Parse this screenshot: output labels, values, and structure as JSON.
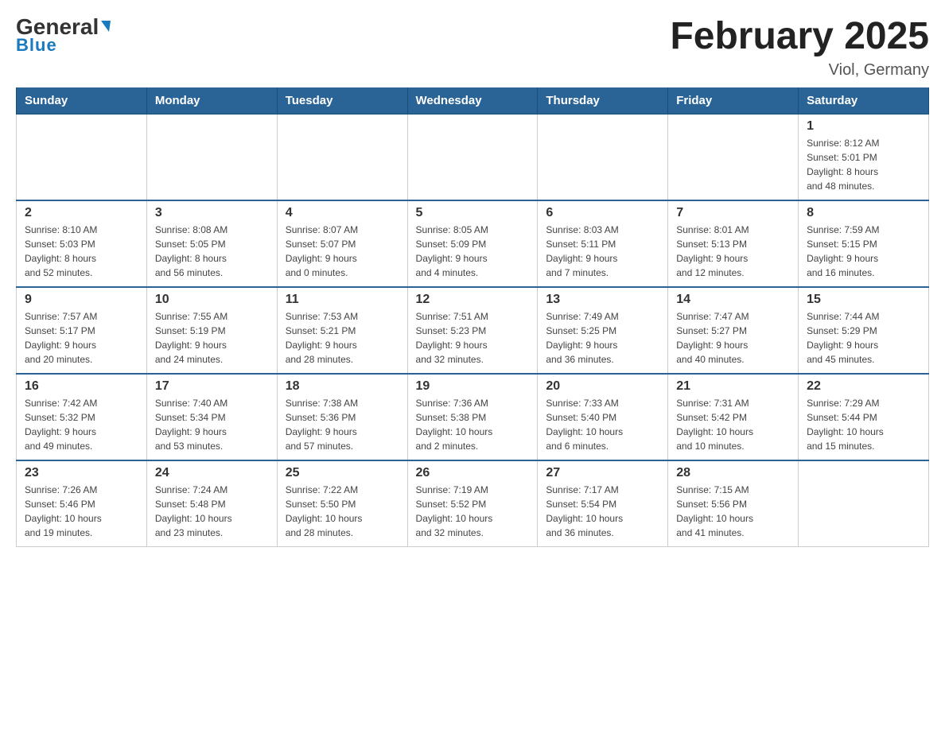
{
  "header": {
    "logo_text_black": "General",
    "logo_text_blue": "Blue",
    "month_title": "February 2025",
    "location": "Viol, Germany"
  },
  "days_of_week": [
    "Sunday",
    "Monday",
    "Tuesday",
    "Wednesday",
    "Thursday",
    "Friday",
    "Saturday"
  ],
  "weeks": [
    {
      "days": [
        {
          "number": "",
          "info": ""
        },
        {
          "number": "",
          "info": ""
        },
        {
          "number": "",
          "info": ""
        },
        {
          "number": "",
          "info": ""
        },
        {
          "number": "",
          "info": ""
        },
        {
          "number": "",
          "info": ""
        },
        {
          "number": "1",
          "info": "Sunrise: 8:12 AM\nSunset: 5:01 PM\nDaylight: 8 hours\nand 48 minutes."
        }
      ]
    },
    {
      "days": [
        {
          "number": "2",
          "info": "Sunrise: 8:10 AM\nSunset: 5:03 PM\nDaylight: 8 hours\nand 52 minutes."
        },
        {
          "number": "3",
          "info": "Sunrise: 8:08 AM\nSunset: 5:05 PM\nDaylight: 8 hours\nand 56 minutes."
        },
        {
          "number": "4",
          "info": "Sunrise: 8:07 AM\nSunset: 5:07 PM\nDaylight: 9 hours\nand 0 minutes."
        },
        {
          "number": "5",
          "info": "Sunrise: 8:05 AM\nSunset: 5:09 PM\nDaylight: 9 hours\nand 4 minutes."
        },
        {
          "number": "6",
          "info": "Sunrise: 8:03 AM\nSunset: 5:11 PM\nDaylight: 9 hours\nand 7 minutes."
        },
        {
          "number": "7",
          "info": "Sunrise: 8:01 AM\nSunset: 5:13 PM\nDaylight: 9 hours\nand 12 minutes."
        },
        {
          "number": "8",
          "info": "Sunrise: 7:59 AM\nSunset: 5:15 PM\nDaylight: 9 hours\nand 16 minutes."
        }
      ]
    },
    {
      "days": [
        {
          "number": "9",
          "info": "Sunrise: 7:57 AM\nSunset: 5:17 PM\nDaylight: 9 hours\nand 20 minutes."
        },
        {
          "number": "10",
          "info": "Sunrise: 7:55 AM\nSunset: 5:19 PM\nDaylight: 9 hours\nand 24 minutes."
        },
        {
          "number": "11",
          "info": "Sunrise: 7:53 AM\nSunset: 5:21 PM\nDaylight: 9 hours\nand 28 minutes."
        },
        {
          "number": "12",
          "info": "Sunrise: 7:51 AM\nSunset: 5:23 PM\nDaylight: 9 hours\nand 32 minutes."
        },
        {
          "number": "13",
          "info": "Sunrise: 7:49 AM\nSunset: 5:25 PM\nDaylight: 9 hours\nand 36 minutes."
        },
        {
          "number": "14",
          "info": "Sunrise: 7:47 AM\nSunset: 5:27 PM\nDaylight: 9 hours\nand 40 minutes."
        },
        {
          "number": "15",
          "info": "Sunrise: 7:44 AM\nSunset: 5:29 PM\nDaylight: 9 hours\nand 45 minutes."
        }
      ]
    },
    {
      "days": [
        {
          "number": "16",
          "info": "Sunrise: 7:42 AM\nSunset: 5:32 PM\nDaylight: 9 hours\nand 49 minutes."
        },
        {
          "number": "17",
          "info": "Sunrise: 7:40 AM\nSunset: 5:34 PM\nDaylight: 9 hours\nand 53 minutes."
        },
        {
          "number": "18",
          "info": "Sunrise: 7:38 AM\nSunset: 5:36 PM\nDaylight: 9 hours\nand 57 minutes."
        },
        {
          "number": "19",
          "info": "Sunrise: 7:36 AM\nSunset: 5:38 PM\nDaylight: 10 hours\nand 2 minutes."
        },
        {
          "number": "20",
          "info": "Sunrise: 7:33 AM\nSunset: 5:40 PM\nDaylight: 10 hours\nand 6 minutes."
        },
        {
          "number": "21",
          "info": "Sunrise: 7:31 AM\nSunset: 5:42 PM\nDaylight: 10 hours\nand 10 minutes."
        },
        {
          "number": "22",
          "info": "Sunrise: 7:29 AM\nSunset: 5:44 PM\nDaylight: 10 hours\nand 15 minutes."
        }
      ]
    },
    {
      "days": [
        {
          "number": "23",
          "info": "Sunrise: 7:26 AM\nSunset: 5:46 PM\nDaylight: 10 hours\nand 19 minutes."
        },
        {
          "number": "24",
          "info": "Sunrise: 7:24 AM\nSunset: 5:48 PM\nDaylight: 10 hours\nand 23 minutes."
        },
        {
          "number": "25",
          "info": "Sunrise: 7:22 AM\nSunset: 5:50 PM\nDaylight: 10 hours\nand 28 minutes."
        },
        {
          "number": "26",
          "info": "Sunrise: 7:19 AM\nSunset: 5:52 PM\nDaylight: 10 hours\nand 32 minutes."
        },
        {
          "number": "27",
          "info": "Sunrise: 7:17 AM\nSunset: 5:54 PM\nDaylight: 10 hours\nand 36 minutes."
        },
        {
          "number": "28",
          "info": "Sunrise: 7:15 AM\nSunset: 5:56 PM\nDaylight: 10 hours\nand 41 minutes."
        },
        {
          "number": "",
          "info": ""
        }
      ]
    }
  ]
}
